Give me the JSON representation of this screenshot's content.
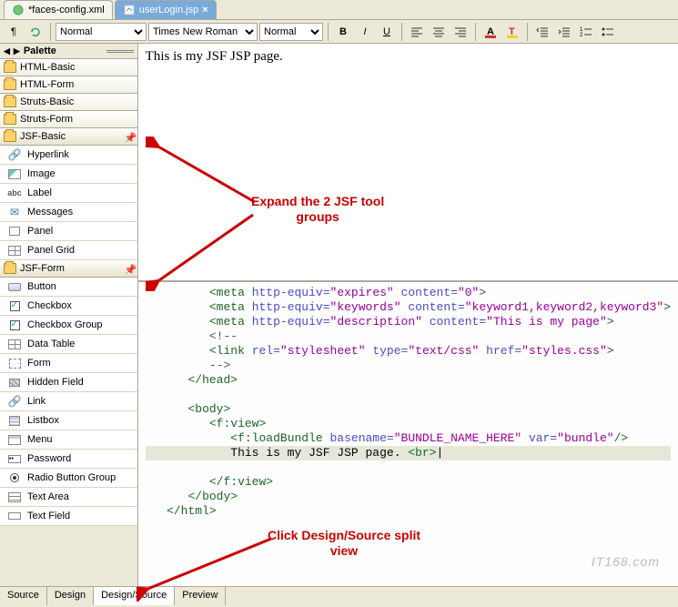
{
  "tabs": [
    {
      "label": "*faces-config.xml",
      "active": false
    },
    {
      "label": "userLogin.jsp",
      "active": true
    }
  ],
  "toolbar": {
    "paragraph_style": "Normal",
    "font_family": "Times New Roman",
    "font_size": "Normal"
  },
  "palette": {
    "title": "Palette",
    "groups": {
      "html_basic": "HTML-Basic",
      "html_form": "HTML-Form",
      "struts_basic": "Struts-Basic",
      "struts_form": "Struts-Form",
      "jsf_basic": "JSF-Basic",
      "jsf_form": "JSF-Form"
    },
    "jsf_basic_items": [
      "Hyperlink",
      "Image",
      "Label",
      "Messages",
      "Panel",
      "Panel Grid"
    ],
    "jsf_form_items": [
      "Button",
      "Checkbox",
      "Checkbox Group",
      "Data Table",
      "Form",
      "Hidden Field",
      "Link",
      "Listbox",
      "Menu",
      "Password",
      "Radio Button Group",
      "Text Area",
      "Text Field"
    ]
  },
  "design": {
    "body_text": "This is my JSF JSP page."
  },
  "source": {
    "lines": [
      {
        "indent": 3,
        "parts": [
          {
            "t": "tag",
            "v": "<meta "
          },
          {
            "t": "attr",
            "v": "http-equiv="
          },
          {
            "t": "str",
            "v": "\"expires\""
          },
          {
            "t": "attr",
            "v": " content="
          },
          {
            "t": "str",
            "v": "\"0\""
          },
          {
            "t": "tag",
            "v": ">"
          }
        ]
      },
      {
        "indent": 3,
        "parts": [
          {
            "t": "tag",
            "v": "<meta "
          },
          {
            "t": "attr",
            "v": "http-equiv="
          },
          {
            "t": "str",
            "v": "\"keywords\""
          },
          {
            "t": "attr",
            "v": " content="
          },
          {
            "t": "str",
            "v": "\"keyword1,keyword2,keyword3\""
          },
          {
            "t": "tag",
            "v": ">"
          }
        ]
      },
      {
        "indent": 3,
        "parts": [
          {
            "t": "tag",
            "v": "<meta "
          },
          {
            "t": "attr",
            "v": "http-equiv="
          },
          {
            "t": "str",
            "v": "\"description\""
          },
          {
            "t": "attr",
            "v": " content="
          },
          {
            "t": "str",
            "v": "\"This is my page\""
          },
          {
            "t": "tag",
            "v": ">"
          }
        ]
      },
      {
        "indent": 3,
        "parts": [
          {
            "t": "cmt",
            "v": "<!--"
          }
        ]
      },
      {
        "indent": 3,
        "parts": [
          {
            "t": "tag",
            "v": "<link "
          },
          {
            "t": "attr",
            "v": "rel="
          },
          {
            "t": "str",
            "v": "\"stylesheet\""
          },
          {
            "t": "attr",
            "v": " type="
          },
          {
            "t": "str",
            "v": "\"text/css\""
          },
          {
            "t": "attr",
            "v": " href="
          },
          {
            "t": "str",
            "v": "\"styles.css\""
          },
          {
            "t": "tag",
            "v": ">"
          }
        ]
      },
      {
        "indent": 3,
        "parts": [
          {
            "t": "cmt",
            "v": "-->"
          }
        ]
      },
      {
        "indent": 2,
        "parts": [
          {
            "t": "tag",
            "v": "</head>"
          }
        ]
      },
      {
        "indent": 2,
        "parts": [
          {
            "t": "txt",
            "v": " "
          }
        ]
      },
      {
        "indent": 2,
        "parts": [
          {
            "t": "tag",
            "v": "<body>"
          }
        ]
      },
      {
        "indent": 3,
        "parts": [
          {
            "t": "tag",
            "v": "<f:view>"
          }
        ]
      },
      {
        "indent": 4,
        "parts": [
          {
            "t": "tag",
            "v": "<f:loadBundle "
          },
          {
            "t": "attr",
            "v": "basename="
          },
          {
            "t": "str",
            "v": "\"BUNDLE_NAME_HERE\""
          },
          {
            "t": "attr",
            "v": " var="
          },
          {
            "t": "str",
            "v": "\"bundle\""
          },
          {
            "t": "tag",
            "v": "/>"
          }
        ]
      },
      {
        "indent": 4,
        "hl": true,
        "parts": [
          {
            "t": "txt",
            "v": "This is my JSF JSP page. "
          },
          {
            "t": "tag",
            "v": "<br>"
          }
        ]
      },
      {
        "indent": 3,
        "parts": [
          {
            "t": "tag",
            "v": "</f:view>"
          }
        ]
      },
      {
        "indent": 2,
        "parts": [
          {
            "t": "tag",
            "v": "</body>"
          }
        ]
      },
      {
        "indent": 1,
        "parts": [
          {
            "t": "tag",
            "v": "</html>"
          }
        ]
      }
    ]
  },
  "view_tabs": [
    "Source",
    "Design",
    "Design/Source",
    "Preview"
  ],
  "active_view_tab": "Design/Source",
  "annotations": {
    "expand": "Expand the 2 JSF tool\ngroups",
    "split": "Click Design/Source split\nview"
  },
  "watermark": "IT168.com"
}
